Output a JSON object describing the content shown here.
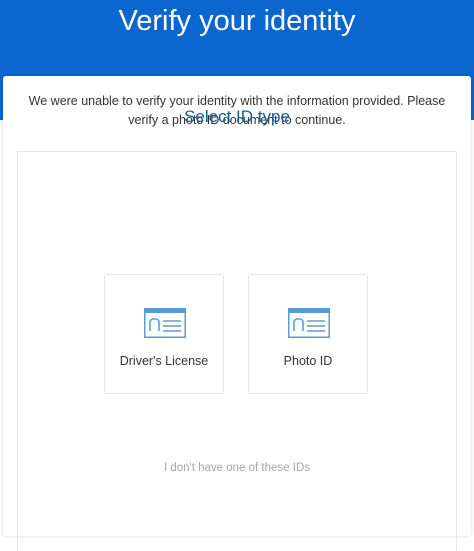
{
  "header": {
    "title": "Verify your identity",
    "background": "#0b66cf"
  },
  "message": {
    "text": "We were unable to verify your identity with the information provided. Please verify a photo ID document to continue."
  },
  "id_selection": {
    "title": "Select ID type",
    "options": [
      {
        "label": "Driver's License",
        "icon": "id-card-icon"
      },
      {
        "label": "Photo ID",
        "icon": "id-card-icon"
      }
    ]
  },
  "no_id_link": {
    "text": "I don't have one of these IDs"
  },
  "colors": {
    "accent": "#1a5a9a",
    "icon_blue": "#5b9bd5",
    "link_gray": "#a6a6a6"
  }
}
